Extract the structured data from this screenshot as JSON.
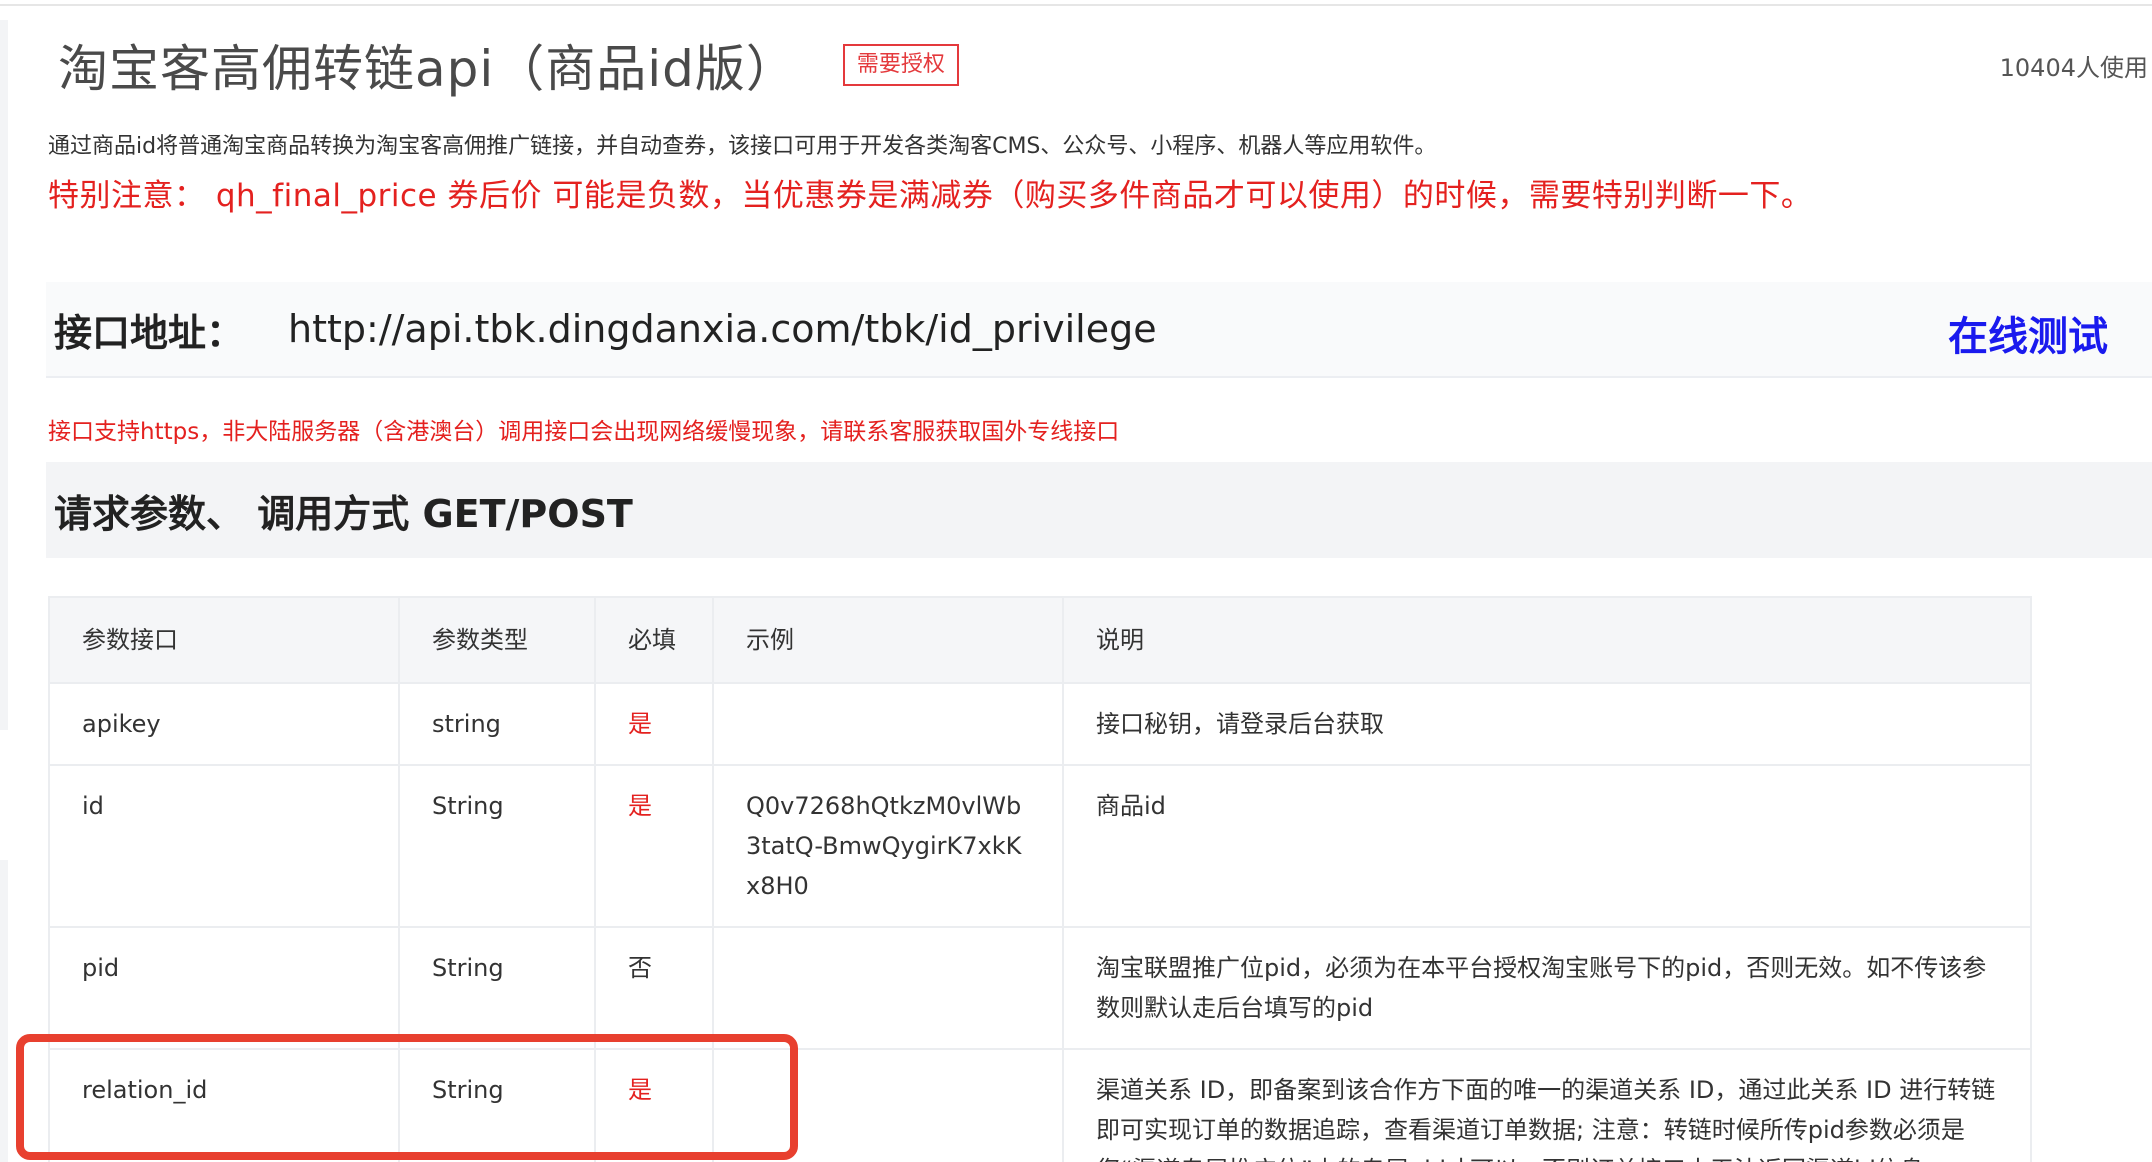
{
  "header": {
    "title": "淘宝客高佣转链api（商品id版）",
    "auth_badge": "需要授权",
    "usage_count": "10404人使用"
  },
  "description": "通过商品id将普通淘宝商品转换为淘宝客高佣推广链接，并自动查券，该接口可用于开发各类淘客CMS、公众号、小程序、机器人等应用软件。",
  "notice": "特别注意： qh_final_price 券后价 可能是负数，当优惠券是满减券（购买多件商品才可以使用）的时候，需要特别判断一下。",
  "endpoint": {
    "label": "接口地址：",
    "url": "http://api.tbk.dingdanxia.com/tbk/id_privilege",
    "test_label": "在线测试"
  },
  "https_note": "接口支持https，非大陆服务器（含港澳台）调用接口会出现网络缓慢现象，请联系客服获取国外专线接口",
  "params_section": {
    "title": "请求参数、 调用方式 GET/POST"
  },
  "table": {
    "headers": [
      "参数接口",
      "参数类型",
      "必填",
      "示例",
      "说明"
    ],
    "rows": [
      {
        "name": "apikey",
        "type": "string",
        "required": "是",
        "example": "",
        "desc": "接口秘钥，请登录后台获取"
      },
      {
        "name": "id",
        "type": "String",
        "required": "是",
        "example": "Q0v7268hQtkzM0vlWb3tatQ-BmwQygirK7xkKx8H0",
        "desc": "商品id"
      },
      {
        "name": "pid",
        "type": "String",
        "required": "否",
        "example": "",
        "desc": "淘宝联盟推广位pid，必须为在本平台授权淘宝账号下的pid，否则无效。如不传该参数则默认走后台填写的pid"
      },
      {
        "name": "relation_id",
        "type": "String",
        "required": "是",
        "example": "",
        "desc": "渠道关系 ID，即备案到该合作方下面的唯一的渠道关系 ID，通过此关系 ID 进行转链即可实现订单的数据追踪，查看渠道订单数据; 注意：转链时候所传pid参数必须是您“渠道专属推广位”内的专属pid才可以，否则订单接口中无法返回渠道id信息"
      }
    ]
  },
  "colors": {
    "accent_red": "#e4211f",
    "link_blue": "#1a1aee",
    "highlight_red": "#e8402f"
  }
}
